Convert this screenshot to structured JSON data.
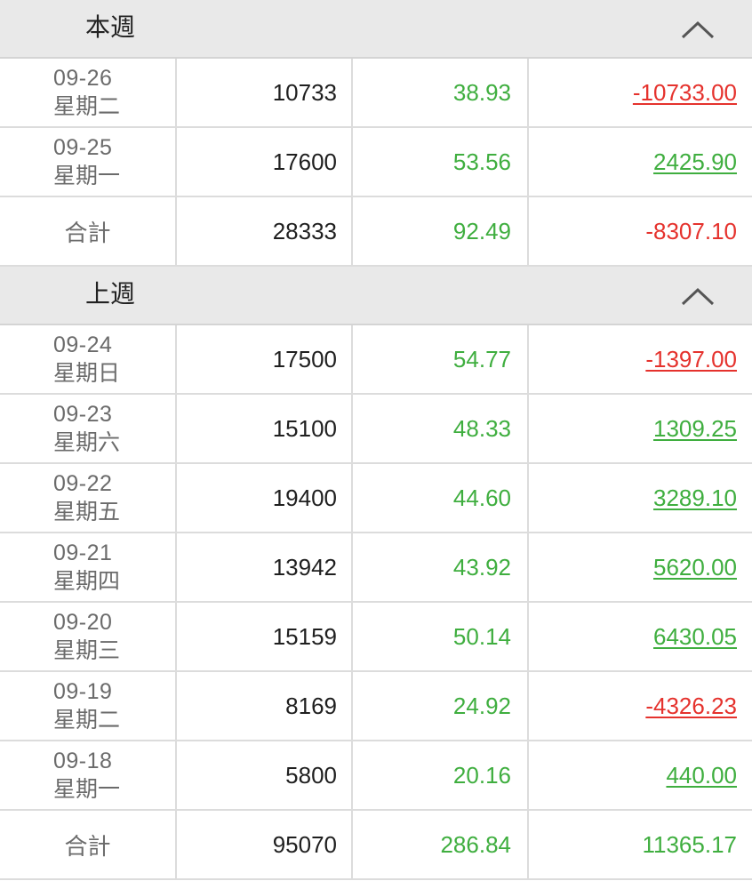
{
  "colors": {
    "positive": "#3fae3f",
    "negative": "#e5322d",
    "header_bg": "#e9e9e9"
  },
  "this_week": {
    "title": "本週",
    "toggle_icon": "chevron-up-icon",
    "rows": [
      {
        "date": "09-26",
        "day": "星期二",
        "volume": "10733",
        "value": "38.93",
        "amount": "-10733.00",
        "sign": "neg"
      },
      {
        "date": "09-25",
        "day": "星期一",
        "volume": "17600",
        "value": "53.56",
        "amount": "2425.90",
        "sign": "pos"
      }
    ],
    "total": {
      "label": "合計",
      "volume": "28333",
      "value": "92.49",
      "amount": "-8307.10",
      "sign": "neg"
    }
  },
  "last_week": {
    "title": "上週",
    "toggle_icon": "chevron-up-icon",
    "rows": [
      {
        "date": "09-24",
        "day": "星期日",
        "volume": "17500",
        "value": "54.77",
        "amount": "-1397.00",
        "sign": "neg"
      },
      {
        "date": "09-23",
        "day": "星期六",
        "volume": "15100",
        "value": "48.33",
        "amount": "1309.25",
        "sign": "pos"
      },
      {
        "date": "09-22",
        "day": "星期五",
        "volume": "19400",
        "value": "44.60",
        "amount": "3289.10",
        "sign": "pos"
      },
      {
        "date": "09-21",
        "day": "星期四",
        "volume": "13942",
        "value": "43.92",
        "amount": "5620.00",
        "sign": "pos"
      },
      {
        "date": "09-20",
        "day": "星期三",
        "volume": "15159",
        "value": "50.14",
        "amount": "6430.05",
        "sign": "pos"
      },
      {
        "date": "09-19",
        "day": "星期二",
        "volume": "8169",
        "value": "24.92",
        "amount": "-4326.23",
        "sign": "neg"
      },
      {
        "date": "09-18",
        "day": "星期一",
        "volume": "5800",
        "value": "20.16",
        "amount": "440.00",
        "sign": "pos"
      }
    ],
    "total": {
      "label": "合計",
      "volume": "95070",
      "value": "286.84",
      "amount": "11365.17",
      "sign": "pos"
    }
  }
}
